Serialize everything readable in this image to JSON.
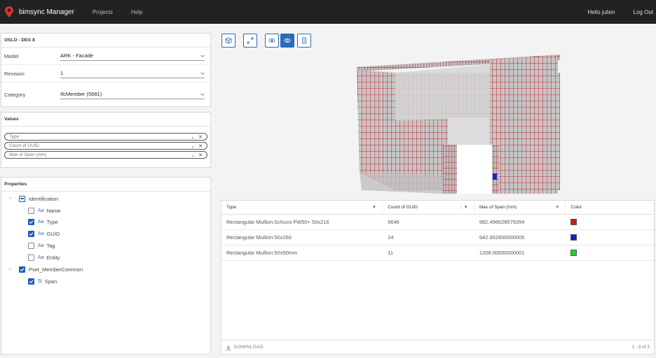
{
  "navbar": {
    "brand": "bimsync Manager",
    "links": [
      "Projects",
      "Help"
    ],
    "greeting": "Hello julien",
    "logout": "Log Out",
    "logo_color": "#d9342b"
  },
  "config_panel": {
    "title": "OSLO - DEG 8",
    "fields": [
      {
        "label": "Model",
        "value": "ARK - Facade"
      },
      {
        "label": "Revision",
        "value": "1"
      },
      {
        "label": "Category",
        "value": "IfcMember (5681)"
      }
    ]
  },
  "values_panel": {
    "title": "Values",
    "chips": [
      "Type",
      "Count of GUID",
      "Max of Span (mm)"
    ],
    "chip_dropdown_glyph": "⌄",
    "chip_remove_glyph": "✕"
  },
  "properties_panel": {
    "title": "Properties",
    "expander_glyph": "⌵",
    "groups": [
      {
        "name": "Identification",
        "state": "partial",
        "items": [
          {
            "name": "Name",
            "checked": false,
            "type_icon": "Aa"
          },
          {
            "name": "Type",
            "checked": true,
            "type_icon": "Aa"
          },
          {
            "name": "GUID",
            "checked": true,
            "type_icon": "Aa"
          },
          {
            "name": "Tag",
            "checked": false,
            "type_icon": "Aa"
          },
          {
            "name": "Entity",
            "checked": false,
            "type_icon": "Aa"
          }
        ]
      },
      {
        "name": "Pset_MemberCommon",
        "state": "checked",
        "items": [
          {
            "name": "Span",
            "checked": true,
            "type_icon": "5|"
          }
        ]
      }
    ]
  },
  "viewer_toolbar": [
    {
      "icon": "cube-icon",
      "active": false
    },
    {
      "icon": "expand-icon",
      "active": false
    },
    {
      "icon": "eye-icon",
      "active": false
    },
    {
      "icon": "eye-outline-icon",
      "active": true
    },
    {
      "icon": "list-icon",
      "active": false
    }
  ],
  "table": {
    "columns": [
      {
        "label": "Type",
        "sort": "▼"
      },
      {
        "label": "Count of GUID",
        "sort": "↓ ▼"
      },
      {
        "label": "Max of Span (mm)",
        "sort": "▼"
      },
      {
        "label": "Color",
        "sort": ""
      }
    ],
    "rows": [
      {
        "type": "Rectangular Mullion:Schuco FW50+ 50x216",
        "count": "5646",
        "max_span": "982.496628575054",
        "color": "#d61818"
      },
      {
        "type": "Rectangular Mullion:50x260",
        "count": "24",
        "max_span": "942.952850000005",
        "color": "#1a1ad6"
      },
      {
        "type": "Rectangular Mullion:50x50mm",
        "count": "11",
        "max_span": "1208.00000000001",
        "color": "#22d622"
      }
    ],
    "download_label": "DOWNLOAD",
    "pagination": "1 - 3 of 3"
  }
}
